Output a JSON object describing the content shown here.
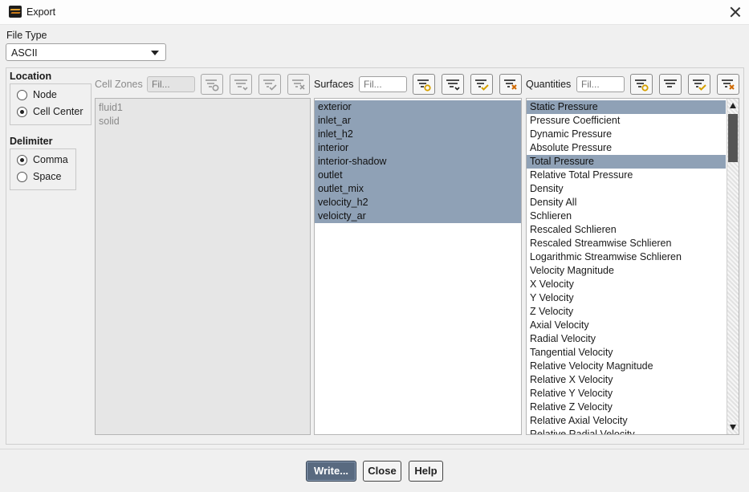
{
  "window": {
    "title": "Export"
  },
  "file_type": {
    "label": "File Type",
    "value": "ASCII"
  },
  "location": {
    "heading": "Location",
    "options": [
      {
        "label": "Node",
        "selected": false
      },
      {
        "label": "Cell Center",
        "selected": true
      }
    ]
  },
  "delimiter": {
    "heading": "Delimiter",
    "options": [
      {
        "label": "Comma",
        "selected": true
      },
      {
        "label": "Space",
        "selected": false
      }
    ]
  },
  "cell_zones": {
    "label": "Cell Zones",
    "filter_placeholder": "Fil...",
    "items": [
      {
        "label": "fluid1",
        "selected": false
      },
      {
        "label": "solid",
        "selected": false
      }
    ]
  },
  "surfaces": {
    "label": "Surfaces",
    "filter_placeholder": "Fil...",
    "items": [
      {
        "label": "exterior",
        "selected": true
      },
      {
        "label": "inlet_ar",
        "selected": true
      },
      {
        "label": "inlet_h2",
        "selected": true
      },
      {
        "label": "interior",
        "selected": true
      },
      {
        "label": "interior-shadow",
        "selected": true
      },
      {
        "label": "outlet",
        "selected": true
      },
      {
        "label": "outlet_mix",
        "selected": true
      },
      {
        "label": "velocity_h2",
        "selected": true
      },
      {
        "label": "veloicty_ar",
        "selected": true
      }
    ]
  },
  "quantities": {
    "label": "Quantities",
    "filter_placeholder": "Fil...",
    "items": [
      {
        "label": "Static Pressure",
        "selected": true
      },
      {
        "label": "Pressure Coefficient",
        "selected": false
      },
      {
        "label": "Dynamic Pressure",
        "selected": false
      },
      {
        "label": "Absolute Pressure",
        "selected": false
      },
      {
        "label": "Total Pressure",
        "selected": true
      },
      {
        "label": "Relative Total Pressure",
        "selected": false
      },
      {
        "label": "Density",
        "selected": false
      },
      {
        "label": "Density All",
        "selected": false
      },
      {
        "label": "Schlieren",
        "selected": false
      },
      {
        "label": "Rescaled Schlieren",
        "selected": false
      },
      {
        "label": "Rescaled Streamwise Schlieren",
        "selected": false
      },
      {
        "label": "Logarithmic Streamwise Schlieren",
        "selected": false
      },
      {
        "label": "Velocity Magnitude",
        "selected": false
      },
      {
        "label": "X Velocity",
        "selected": false
      },
      {
        "label": "Y Velocity",
        "selected": false
      },
      {
        "label": "Z Velocity",
        "selected": false
      },
      {
        "label": "Axial Velocity",
        "selected": false
      },
      {
        "label": "Radial Velocity",
        "selected": false
      },
      {
        "label": "Tangential Velocity",
        "selected": false
      },
      {
        "label": "Relative Velocity Magnitude",
        "selected": false
      },
      {
        "label": "Relative X Velocity",
        "selected": false
      },
      {
        "label": "Relative Y Velocity",
        "selected": false
      },
      {
        "label": "Relative Z Velocity",
        "selected": false
      },
      {
        "label": "Relative Axial Velocity",
        "selected": false
      },
      {
        "label": "Relative Radial Velocity",
        "selected": false
      }
    ]
  },
  "tool_icons": [
    "filter-options-icon",
    "sort-list-icon",
    "select-all-icon",
    "deselect-all-icon"
  ],
  "buttons": {
    "write": "Write...",
    "close": "Close",
    "help": "Help"
  },
  "colors": {
    "selection": "#8fa1b6",
    "primary_button": "#596a80",
    "check_accent": "#d6a000",
    "deselect_accent": "#d06a00"
  }
}
